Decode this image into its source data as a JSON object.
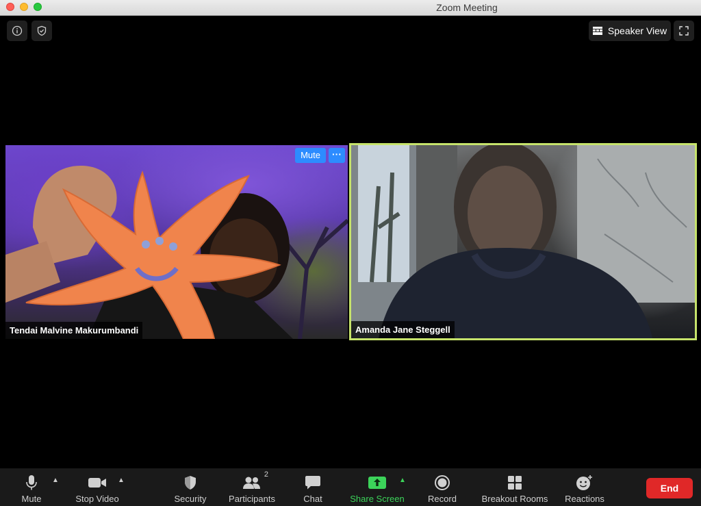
{
  "window": {
    "title": "Zoom Meeting"
  },
  "top_controls": {
    "view_label": "Speaker View"
  },
  "participants_tiles": [
    {
      "name": "Tendai Malvine Makurumbandi",
      "mute_label": "Mute",
      "more_label": "···"
    },
    {
      "name": "Amanda Jane Steggell"
    }
  ],
  "toolbar": {
    "mute": "Mute",
    "stop_video": "Stop Video",
    "security": "Security",
    "participants": "Participants",
    "participants_count": "2",
    "chat": "Chat",
    "share_screen": "Share Screen",
    "record": "Record",
    "breakout_rooms": "Breakout Rooms",
    "reactions": "Reactions",
    "end": "End"
  },
  "colors": {
    "active_speaker_border": "#c6e36b",
    "share_green": "#3cd35a",
    "end_red": "#e02828",
    "zoom_blue": "#2d8cff"
  }
}
